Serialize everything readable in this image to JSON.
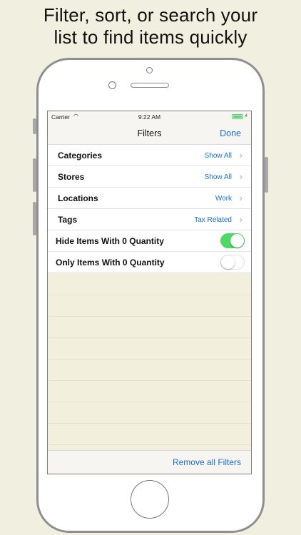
{
  "headline": {
    "line1": "Filter, sort, or search your",
    "line2": "list to find items quickly"
  },
  "status_bar": {
    "carrier": "Carrier",
    "time": "9:22 AM"
  },
  "nav": {
    "title": "Filters",
    "done_label": "Done"
  },
  "filters": [
    {
      "label": "Categories",
      "value": "Show All"
    },
    {
      "label": "Stores",
      "value": "Show All"
    },
    {
      "label": "Locations",
      "value": "Work"
    },
    {
      "label": "Tags",
      "value": "Tax Related"
    }
  ],
  "toggles": [
    {
      "label": "Hide Items With 0 Quantity",
      "on": true
    },
    {
      "label": "Only Items With 0 Quantity",
      "on": false
    }
  ],
  "toolbar": {
    "remove_label": "Remove all Filters"
  },
  "colors": {
    "accent": "#1a6fd0",
    "switch_on": "#4cd964",
    "background": "#f1efdf"
  }
}
